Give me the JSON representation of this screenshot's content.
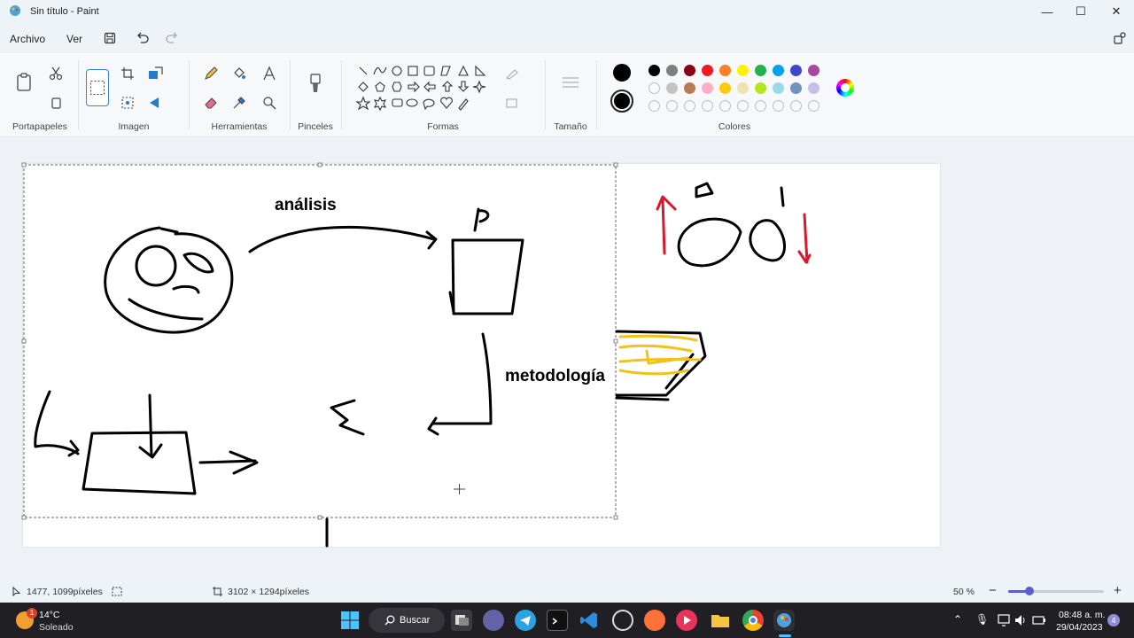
{
  "window": {
    "title": "Sin título - Paint",
    "minimize": "—",
    "maximize": "☐",
    "close": "✕"
  },
  "menu": {
    "archivo": "Archivo",
    "ver": "Ver"
  },
  "ribbon": {
    "groups": {
      "portapapeles": "Portapapeles",
      "imagen": "Imagen",
      "herramientas": "Herramientas",
      "pinceles": "Pinceles",
      "formas": "Formas",
      "tamano": "Tamaño",
      "colores": "Colores"
    },
    "primary_color": "#000000",
    "secondary_color": "#000000",
    "palette_row1": [
      "#000000",
      "#7f7f7f",
      "#880015",
      "#ed1c24",
      "#ff7f27",
      "#fff200",
      "#22b14c",
      "#00a2e8",
      "#3f48cc",
      "#a349a4"
    ],
    "palette_row2": [
      "#ffffff",
      "#c3c3c3",
      "#b97a57",
      "#ffaec9",
      "#ffc90e",
      "#efe4b0",
      "#b5e61d",
      "#99d9ea",
      "#7092be",
      "#c8bfe7"
    ]
  },
  "canvas": {
    "text_analisis": "análisis",
    "text_metodologia": "metodología",
    "text_p": "P"
  },
  "status": {
    "cursor_pos": "1477, 1099píxeles",
    "canvas_size": "3102 × 1294píxeles",
    "zoom": "50 %"
  },
  "taskbar": {
    "weather_temp": "14°C",
    "weather_desc": "Soleado",
    "search": "Buscar",
    "time": "08:48 a. m.",
    "date": "29/04/2023",
    "notif_count": "4",
    "weather_badge": "1"
  }
}
